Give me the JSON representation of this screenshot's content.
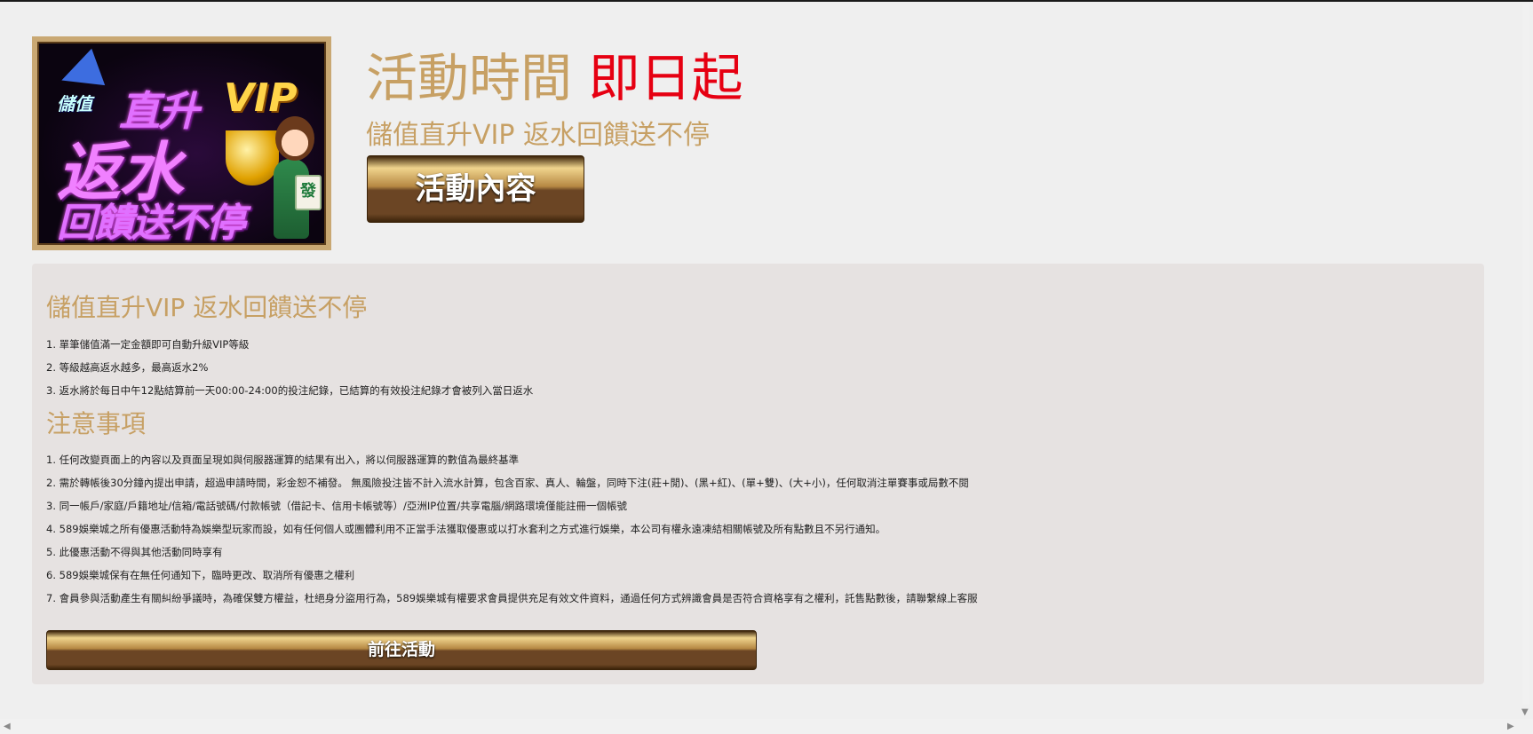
{
  "header": {
    "activity_time_label": "活動時間",
    "activity_time_value": "即日起",
    "subtitle": "儲值直升VIP 返水回饋送不停",
    "content_button": "活動內容"
  },
  "banner": {
    "line_small": "儲值",
    "line1": "直升",
    "vip": "VIP",
    "line2": "返水",
    "line3": "回饋送不停",
    "tile": "發"
  },
  "panel": {
    "section1_title": "儲值直升VIP 返水回饋送不停",
    "section1_items": [
      "1. 單筆儲值滿一定金額即可自動升級VIP等級",
      "2. 等級越高返水越多，最高返水2%",
      "3. 返水將於每日中午12點結算前一天00:00-24:00的投注紀錄，已結算的有效投注紀錄才會被列入當日返水"
    ],
    "section2_title": "注意事項",
    "section2_items": [
      "1. 任何改變頁面上的內容以及頁面呈現如與伺服器運算的結果有出入，將以伺服器運算的數值為最終基準",
      "2. 需於轉帳後30分鐘內提出申請，超過申請時間，彩金恕不補發。 無風險投注皆不計入流水計算，包含百家、真人、輪盤，同時下注(莊+閒)、(黑+紅)、(單+雙)、(大+小)，任何取消注單賽事或局數不閱",
      "3. 同一帳戶/家庭/戶籍地址/信箱/電話號碼/付款帳號（借記卡、信用卡帳號等）/亞洲IP位置/共享電腦/網路環境僅能註冊一個帳號",
      "4. 589娛樂城之所有優惠活動特為娛樂型玩家而設，如有任何個人或團體利用不正當手法獲取優惠或以打水套利之方式進行娛樂，本公司有權永遠凍結相關帳號及所有點數且不另行通知。",
      "5. 此優惠活動不得與其他活動同時享有",
      "6. 589娛樂城保有在無任何通知下，臨時更改、取消所有優惠之權利",
      "7. 會員參與活動產生有關糾紛爭議時，為確保雙方權益，杜絕身分盜用行為，589娛樂城有權要求會員提供充足有效文件資料，通過任何方式辨識會員是否符合資格享有之權利，託售點數後，請聯繫線上客服"
    ],
    "goto_button": "前往活動"
  },
  "scrollbar": {
    "left_arrow": "◀",
    "right_arrow": "▶",
    "down_arrow": "▼"
  }
}
